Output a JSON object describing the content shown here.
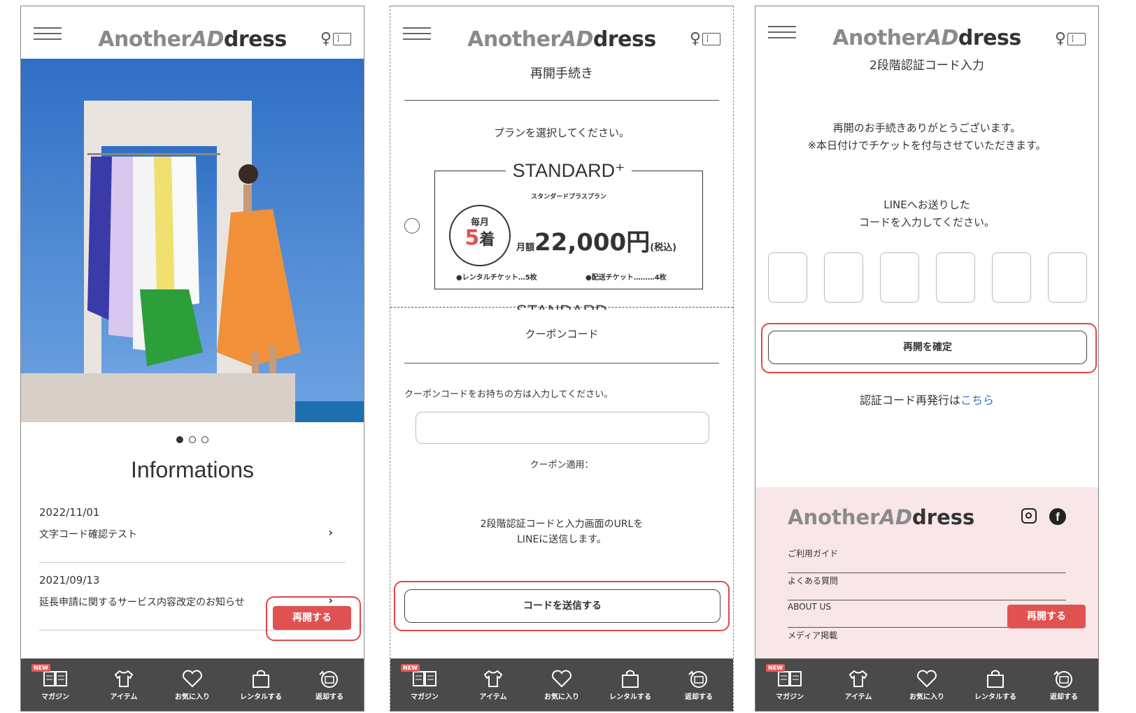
{
  "logo": {
    "part1": "Another",
    "part2": "AD",
    "part3": "dress"
  },
  "tabs": [
    {
      "label": "マガジン",
      "icon": "magazine-icon",
      "badge": "NEW"
    },
    {
      "label": "アイテム",
      "icon": "tshirt-icon"
    },
    {
      "label": "お気に入り",
      "icon": "heart-icon"
    },
    {
      "label": "レンタルする",
      "icon": "bag-icon"
    },
    {
      "label": "返却する",
      "icon": "return-icon"
    }
  ],
  "screen1": {
    "heading": "Informations",
    "news": [
      {
        "date": "2022/11/01",
        "title": "文字コード確認テスト",
        "arrow": "›"
      },
      {
        "date": "2021/09/13",
        "title": "延長申請に関するサービス内容改定のお知らせ",
        "arrow": "›"
      }
    ],
    "resume_button": "再開する"
  },
  "screen2": {
    "title": "再開手続き",
    "plan_prompt": "プランを選択してください。",
    "plan": {
      "name": "STANDARD⁺",
      "sub": "スタンダードプラスプラン",
      "monthly_label": "毎月",
      "count": "5",
      "count_unit": "着",
      "price_prefix": "月額",
      "price": "22,000円",
      "tax": "(税込)",
      "ticket1": "●レンタルチケット…5枚",
      "ticket2": "●配送チケット………4枚",
      "next_plan_peek": "STANDARD"
    },
    "coupon_title": "クーポンコード",
    "coupon_prompt": "クーポンコードをお持ちの方は入力してください。",
    "coupon_applied": "クーポン適用：",
    "notice_line1": "2段階認証コードと入力画面のURLを",
    "notice_line2": "LINEに送信します。",
    "send_button": "コードを送信する"
  },
  "screen3": {
    "title": "2段階認証コード入力",
    "thanks_line1": "再開のお手続きありがとうございます。",
    "thanks_line2": "※本日付けでチケットを付与させていただきます。",
    "line_msg1": "LINEへお送りした",
    "line_msg2": "コードを入力してください。",
    "confirm_button": "再開を確定",
    "reissue_text": "認証コード再発行は",
    "reissue_link": "こちら",
    "footer_links": [
      "ご利用ガイド",
      "よくある質問",
      "ABOUT US",
      "メディア掲載"
    ],
    "resume_button": "再開する"
  },
  "colors": {
    "accent_red": "#e05252",
    "tab_bg": "#4a4a4a",
    "footer_bg": "#f8e6e9",
    "link_blue": "#3a6fd8"
  }
}
